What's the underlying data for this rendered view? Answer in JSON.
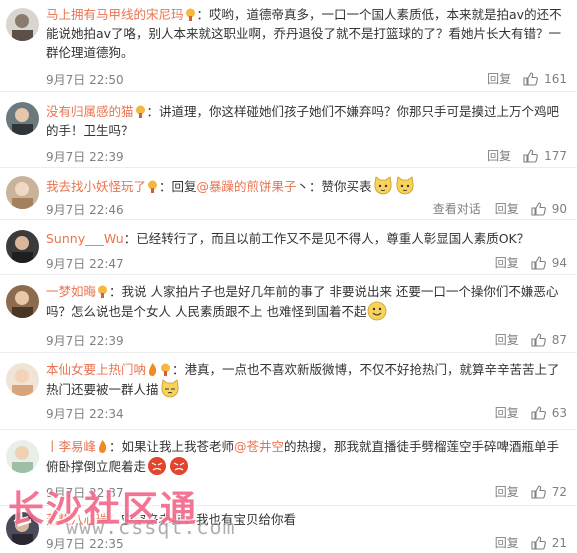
{
  "comments": [
    {
      "username": "马上拥有马甲线的宋尼玛",
      "text": "：哎哟，道德帝真多，一口一个国人素质低，本来就是拍av的还不能说她拍av了咯，别人本来就这职业啊，乔丹退役了就不是打篮球的了？看她片长大有错？一群伦理道德狗。",
      "time": "9月7日 22:50",
      "reply": "回复",
      "likes": "161"
    },
    {
      "username": "没有归属感的猫",
      "text": "：讲道理，你这样碰她们孩子她们不嫌弃吗？你那只手可是摸过上万个鸡吧的手！卫生吗？",
      "time": "9月7日 22:39",
      "reply": "回复",
      "likes": "177"
    },
    {
      "username": "我去找小妖怪玩了",
      "text_before": "：回复",
      "mention": "@暴躁的煎饼果子",
      "text_after": "丶：赞你买表",
      "time": "9月7日 22:46",
      "view_conversation": "查看对话",
      "reply": "回复",
      "likes": "90"
    },
    {
      "username": "Sunny___Wu",
      "text": "：已经转行了，而且以前工作又不是见不得人，尊重人彰显国人素质OK？",
      "time": "9月7日 22:47",
      "reply": "回复",
      "likes": "94"
    },
    {
      "username": "一梦如晦",
      "text": "：我说 人家拍片子也是好几年前的事了 非要说出来 还要一口一个操你们不嫌恶心吗？怎么说也是个女人 人民素质跟不上 也难怪到国着不起",
      "time": "9月7日 22:39",
      "reply": "回复",
      "likes": "87"
    },
    {
      "username": "本仙女要上热门呐",
      "text": "：港真，一点也不喜欢新版微博，不仅不好抢热门，就算辛辛苦苦上了热门还要被一群人描",
      "time": "9月7日 22:34",
      "reply": "回复",
      "likes": "63"
    },
    {
      "username": "丨李易峰",
      "text_before": "：如果让我上我苍老师",
      "mention": "@苍井空",
      "text_after": "的热搜，那我就直播徒手劈榴莲空手碎啤酒瓶单手俯卧撑倒立爬着走",
      "time": "9月7日 22:37",
      "reply": "回复",
      "likes": "72"
    },
    {
      "username": "蒸糕八心瑞",
      "text": "：空空来赤赤，我也有宝贝给你看",
      "time": "9月7日 22:35",
      "reply": "回复",
      "likes": "21"
    }
  ],
  "watermark": {
    "title": "长沙社区通",
    "url": "www.cssqt.com"
  },
  "colors": {
    "username": "#eb7350",
    "text": "#333333",
    "meta": "#808080",
    "watermark": "#f26a8a"
  }
}
